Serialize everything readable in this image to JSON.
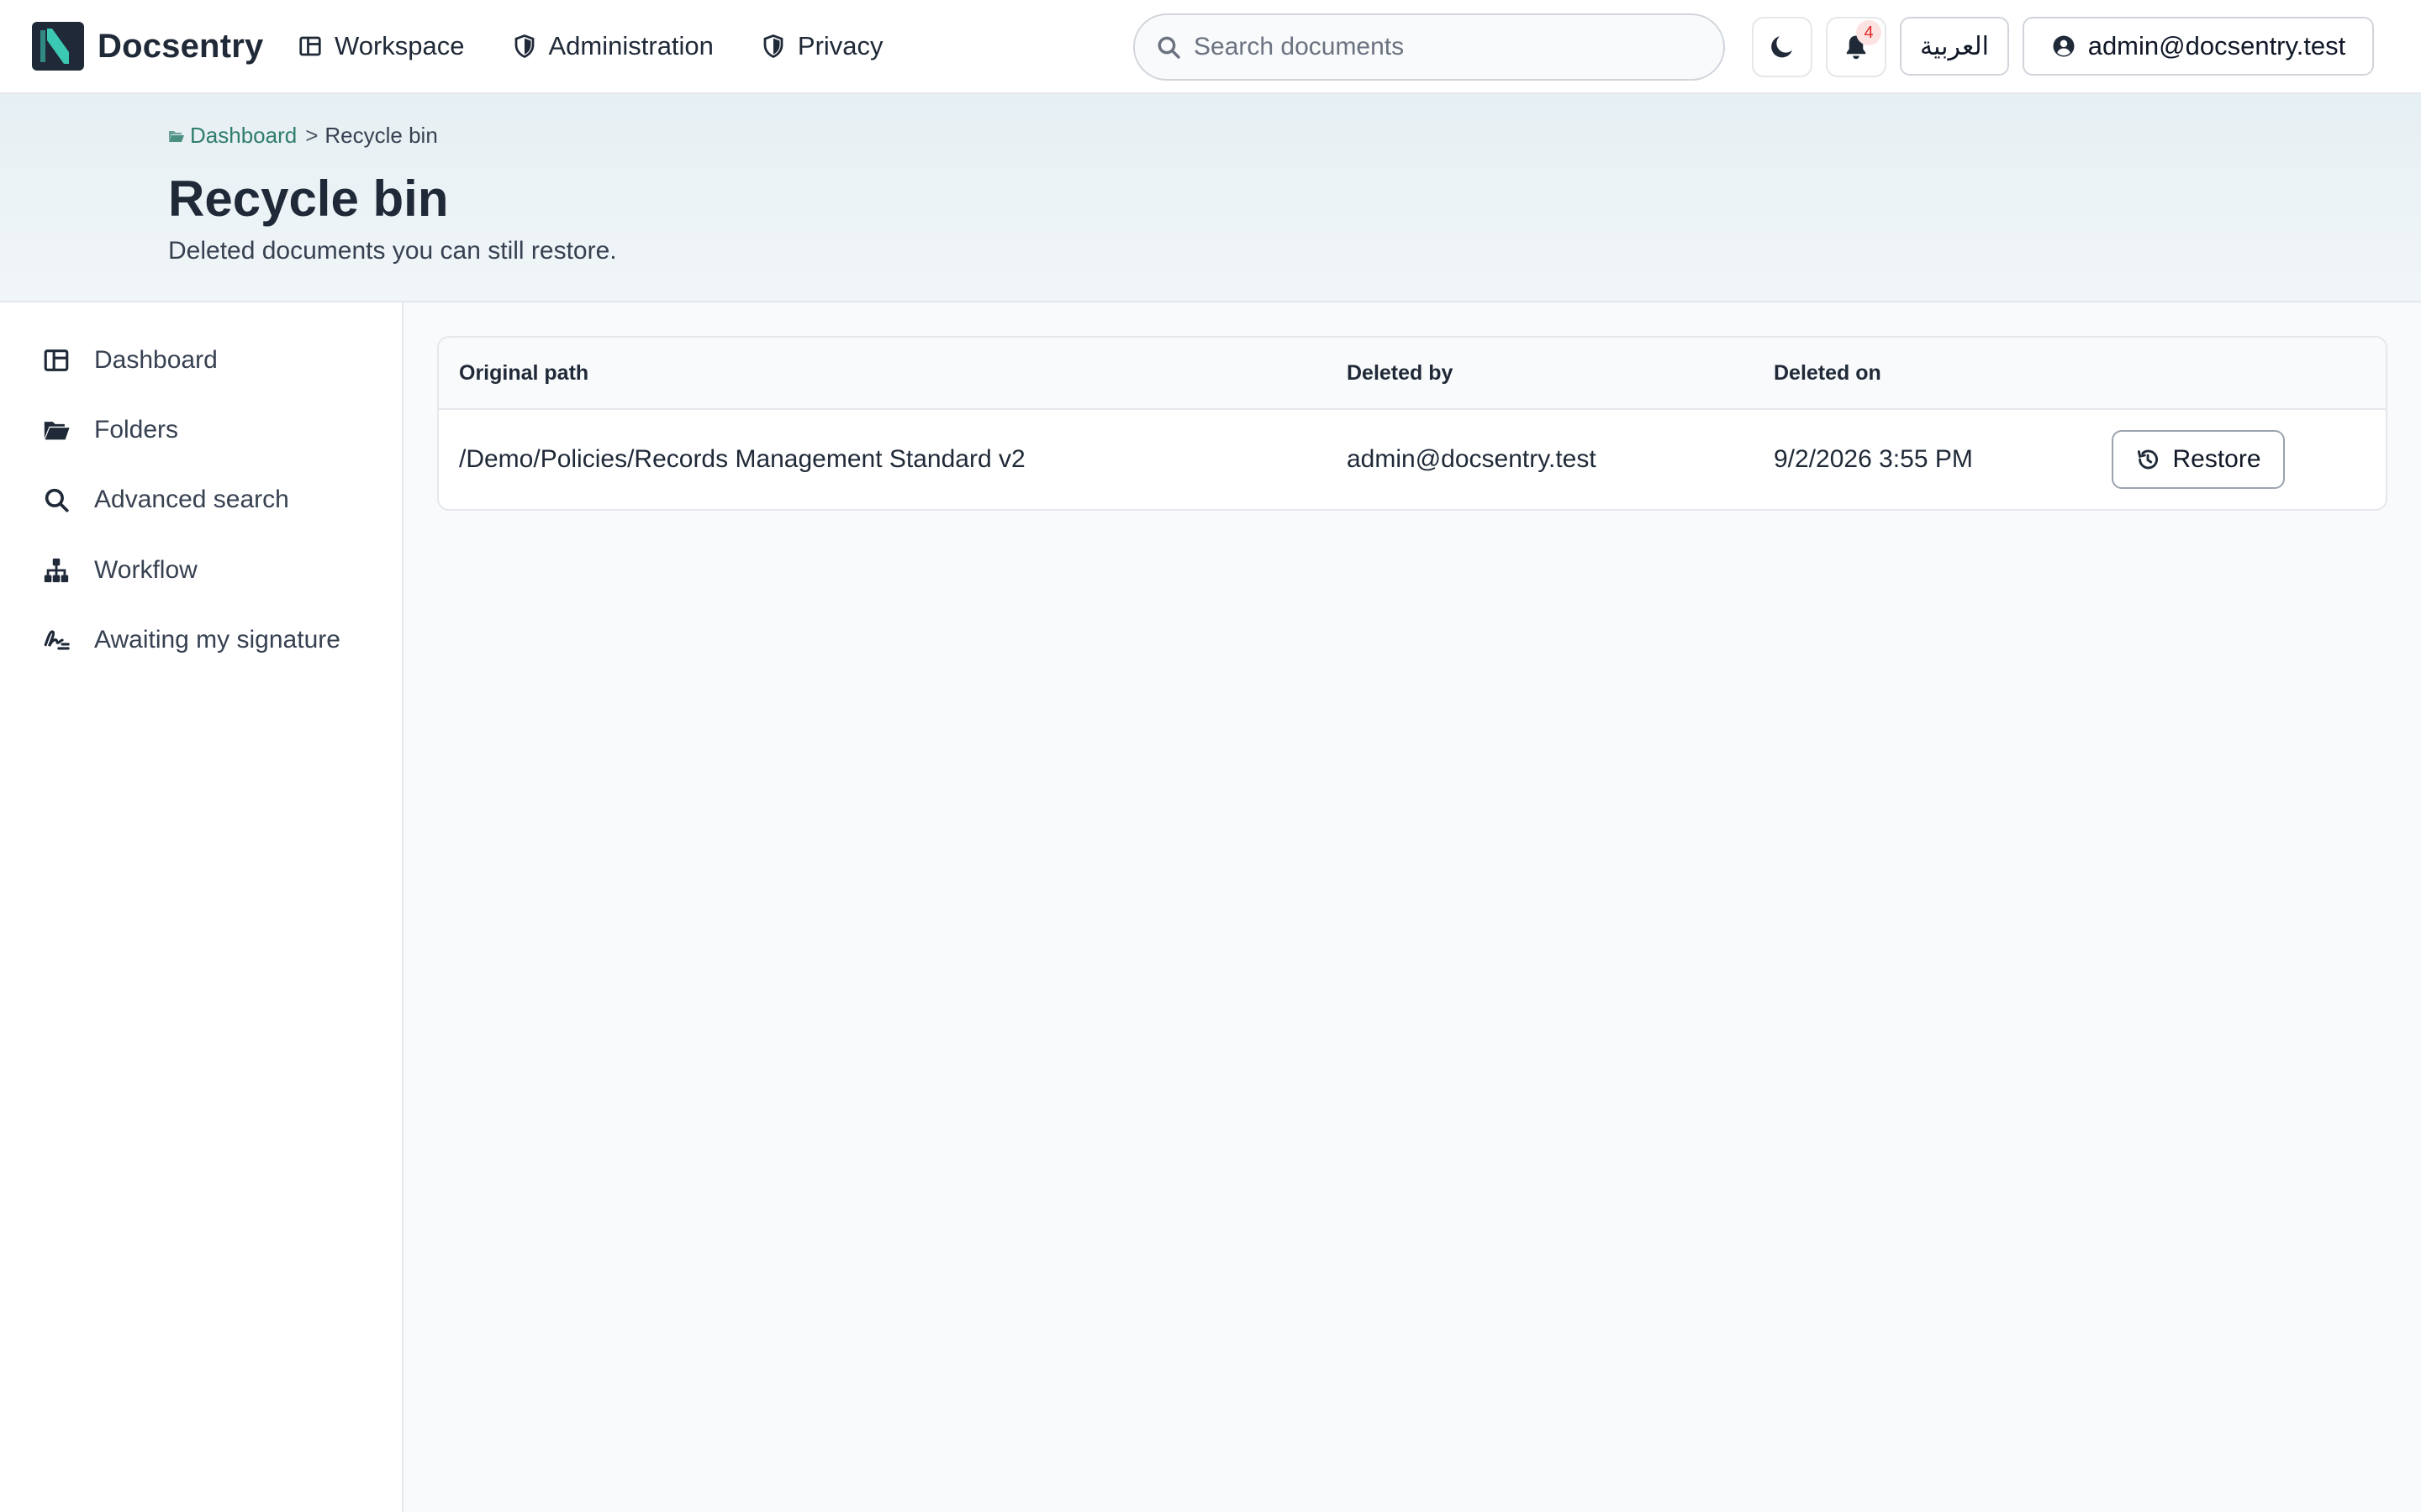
{
  "app": {
    "brand_name": "Docsentry",
    "accent_color": "#2f7d6d"
  },
  "nav": {
    "items": [
      {
        "label": "Workspace",
        "icon": "layout-icon"
      },
      {
        "label": "Administration",
        "icon": "shield-icon"
      },
      {
        "label": "Privacy",
        "icon": "shield-icon"
      }
    ]
  },
  "search": {
    "placeholder": "Search documents",
    "value": ""
  },
  "toolbar": {
    "theme_icon": "moon-icon",
    "notifications_icon": "bell-icon",
    "notifications_count": "4",
    "language_label": "العربية",
    "user_label": "admin@docsentry.test",
    "user_icon": "user-circle-icon"
  },
  "breadcrumb": {
    "parent": "Dashboard",
    "separator": ">",
    "current": "Recycle bin"
  },
  "page": {
    "title": "Recycle bin",
    "subtitle": "Deleted documents you can still restore."
  },
  "sidebar": {
    "items": [
      {
        "label": "Dashboard",
        "icon": "layout-icon"
      },
      {
        "label": "Folders",
        "icon": "folder-open-icon"
      },
      {
        "label": "Advanced search",
        "icon": "search-icon"
      },
      {
        "label": "Workflow",
        "icon": "sitemap-icon"
      },
      {
        "label": "Awaiting my signature",
        "icon": "signature-icon"
      }
    ]
  },
  "table": {
    "columns": [
      "Original path",
      "Deleted by",
      "Deleted on"
    ],
    "rows": [
      {
        "path": "/Demo/Policies/Records Management Standard v2",
        "deleted_by": "admin@docsentry.test",
        "deleted_on": "9/2/2026 3:55 PM",
        "action_label": "Restore",
        "action_icon": "history-icon"
      }
    ]
  }
}
